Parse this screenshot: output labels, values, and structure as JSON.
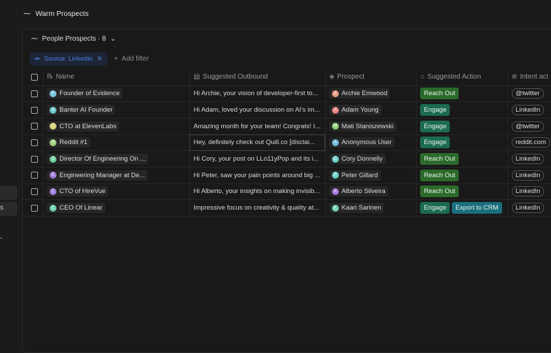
{
  "title": "Warm Prospects",
  "sidebar": {
    "items": [
      "",
      "s"
    ]
  },
  "view": {
    "name": "People Prospects · 8"
  },
  "filters": {
    "active": "Source: Linkedin",
    "add": "Add filter"
  },
  "columns": [
    "Name",
    "Suggested Outbound",
    "Prospect",
    "Suggested Action",
    "Intent act"
  ],
  "colors": {
    "reach_out": "#2c6a2c",
    "engage": "#1c6b52",
    "export": "#1a6e7e"
  },
  "rows": [
    {
      "initial": "F",
      "color": "#7cc3dc",
      "name": "Founder of Evidence",
      "outbound": "Hi Archie, your vision of developer-first to...",
      "pinit": "A",
      "pcolor": "#e39a7e",
      "prospect": "Archie Emwood",
      "actions": [
        {
          "label": "Reach Out",
          "type": "reach_out"
        }
      ],
      "intent": "@twitter"
    },
    {
      "initial": "B",
      "color": "#6dc5c9",
      "name": "Banter AI Founder",
      "outbound": "Hi Adam, loved your discussion on AI's im...",
      "pinit": "A",
      "pcolor": "#e3837e",
      "prospect": "Adam Young",
      "actions": [
        {
          "label": "Engage",
          "type": "engage"
        }
      ],
      "intent": "LinkedIn"
    },
    {
      "initial": "C",
      "color": "#d5d17a",
      "name": "CTO at ElevenLabs",
      "outbound": "Amazing month for your team! Congrats! I...",
      "pinit": "M",
      "pcolor": "#8bcf74",
      "prospect": "Mati Staniszewski",
      "actions": [
        {
          "label": "Engage",
          "type": "engage"
        }
      ],
      "intent": "@twitter"
    },
    {
      "initial": "R",
      "color": "#9ecf78",
      "name": "Reddit #1",
      "outbound": "Hey, definitely check out Quill.co [disclai...",
      "pinit": "A",
      "pcolor": "#6fbcd8",
      "prospect": "Anonymous User",
      "actions": [
        {
          "label": "Engage",
          "type": "engage"
        }
      ],
      "intent": "reddit.com"
    },
    {
      "initial": "D",
      "color": "#6fcf99",
      "name": "Director Of Engineering On ...",
      "outbound": "Hi Cory, your post on LLo11yPop and its i...",
      "pinit": "C",
      "pcolor": "#6fd0c6",
      "prospect": "Cory Donnelly",
      "actions": [
        {
          "label": "Reach Out",
          "type": "reach_out"
        }
      ],
      "intent": "LinkedIn"
    },
    {
      "initial": "E",
      "color": "#a07ad8",
      "name": "Engineering Manager at De...",
      "outbound": "Hi Peter, saw your pain points around big ...",
      "pinit": "P",
      "pcolor": "#6fd0c6",
      "prospect": "Peter Gillard",
      "actions": [
        {
          "label": "Reach Out",
          "type": "reach_out"
        }
      ],
      "intent": "LinkedIn"
    },
    {
      "initial": "C",
      "color": "#a07ad8",
      "name": "CTO of HireVue",
      "outbound": "Hi Alberto, your insights on making invisib...",
      "pinit": "A",
      "pcolor": "#a07ad8",
      "prospect": "Alberto Silveira",
      "actions": [
        {
          "label": "Reach Out",
          "type": "reach_out"
        }
      ],
      "intent": "LinkedIn"
    },
    {
      "initial": "C",
      "color": "#6fd0a8",
      "name": "CEO Of Linear",
      "outbound": "Impressive focus on creativity & quality at...",
      "pinit": "K",
      "pcolor": "#6fd0a8",
      "prospect": "Kaari Sarinen",
      "actions": [
        {
          "label": "Engage",
          "type": "engage"
        },
        {
          "label": "Export to CRM",
          "type": "export"
        }
      ],
      "intent": "LinkedIn"
    }
  ]
}
